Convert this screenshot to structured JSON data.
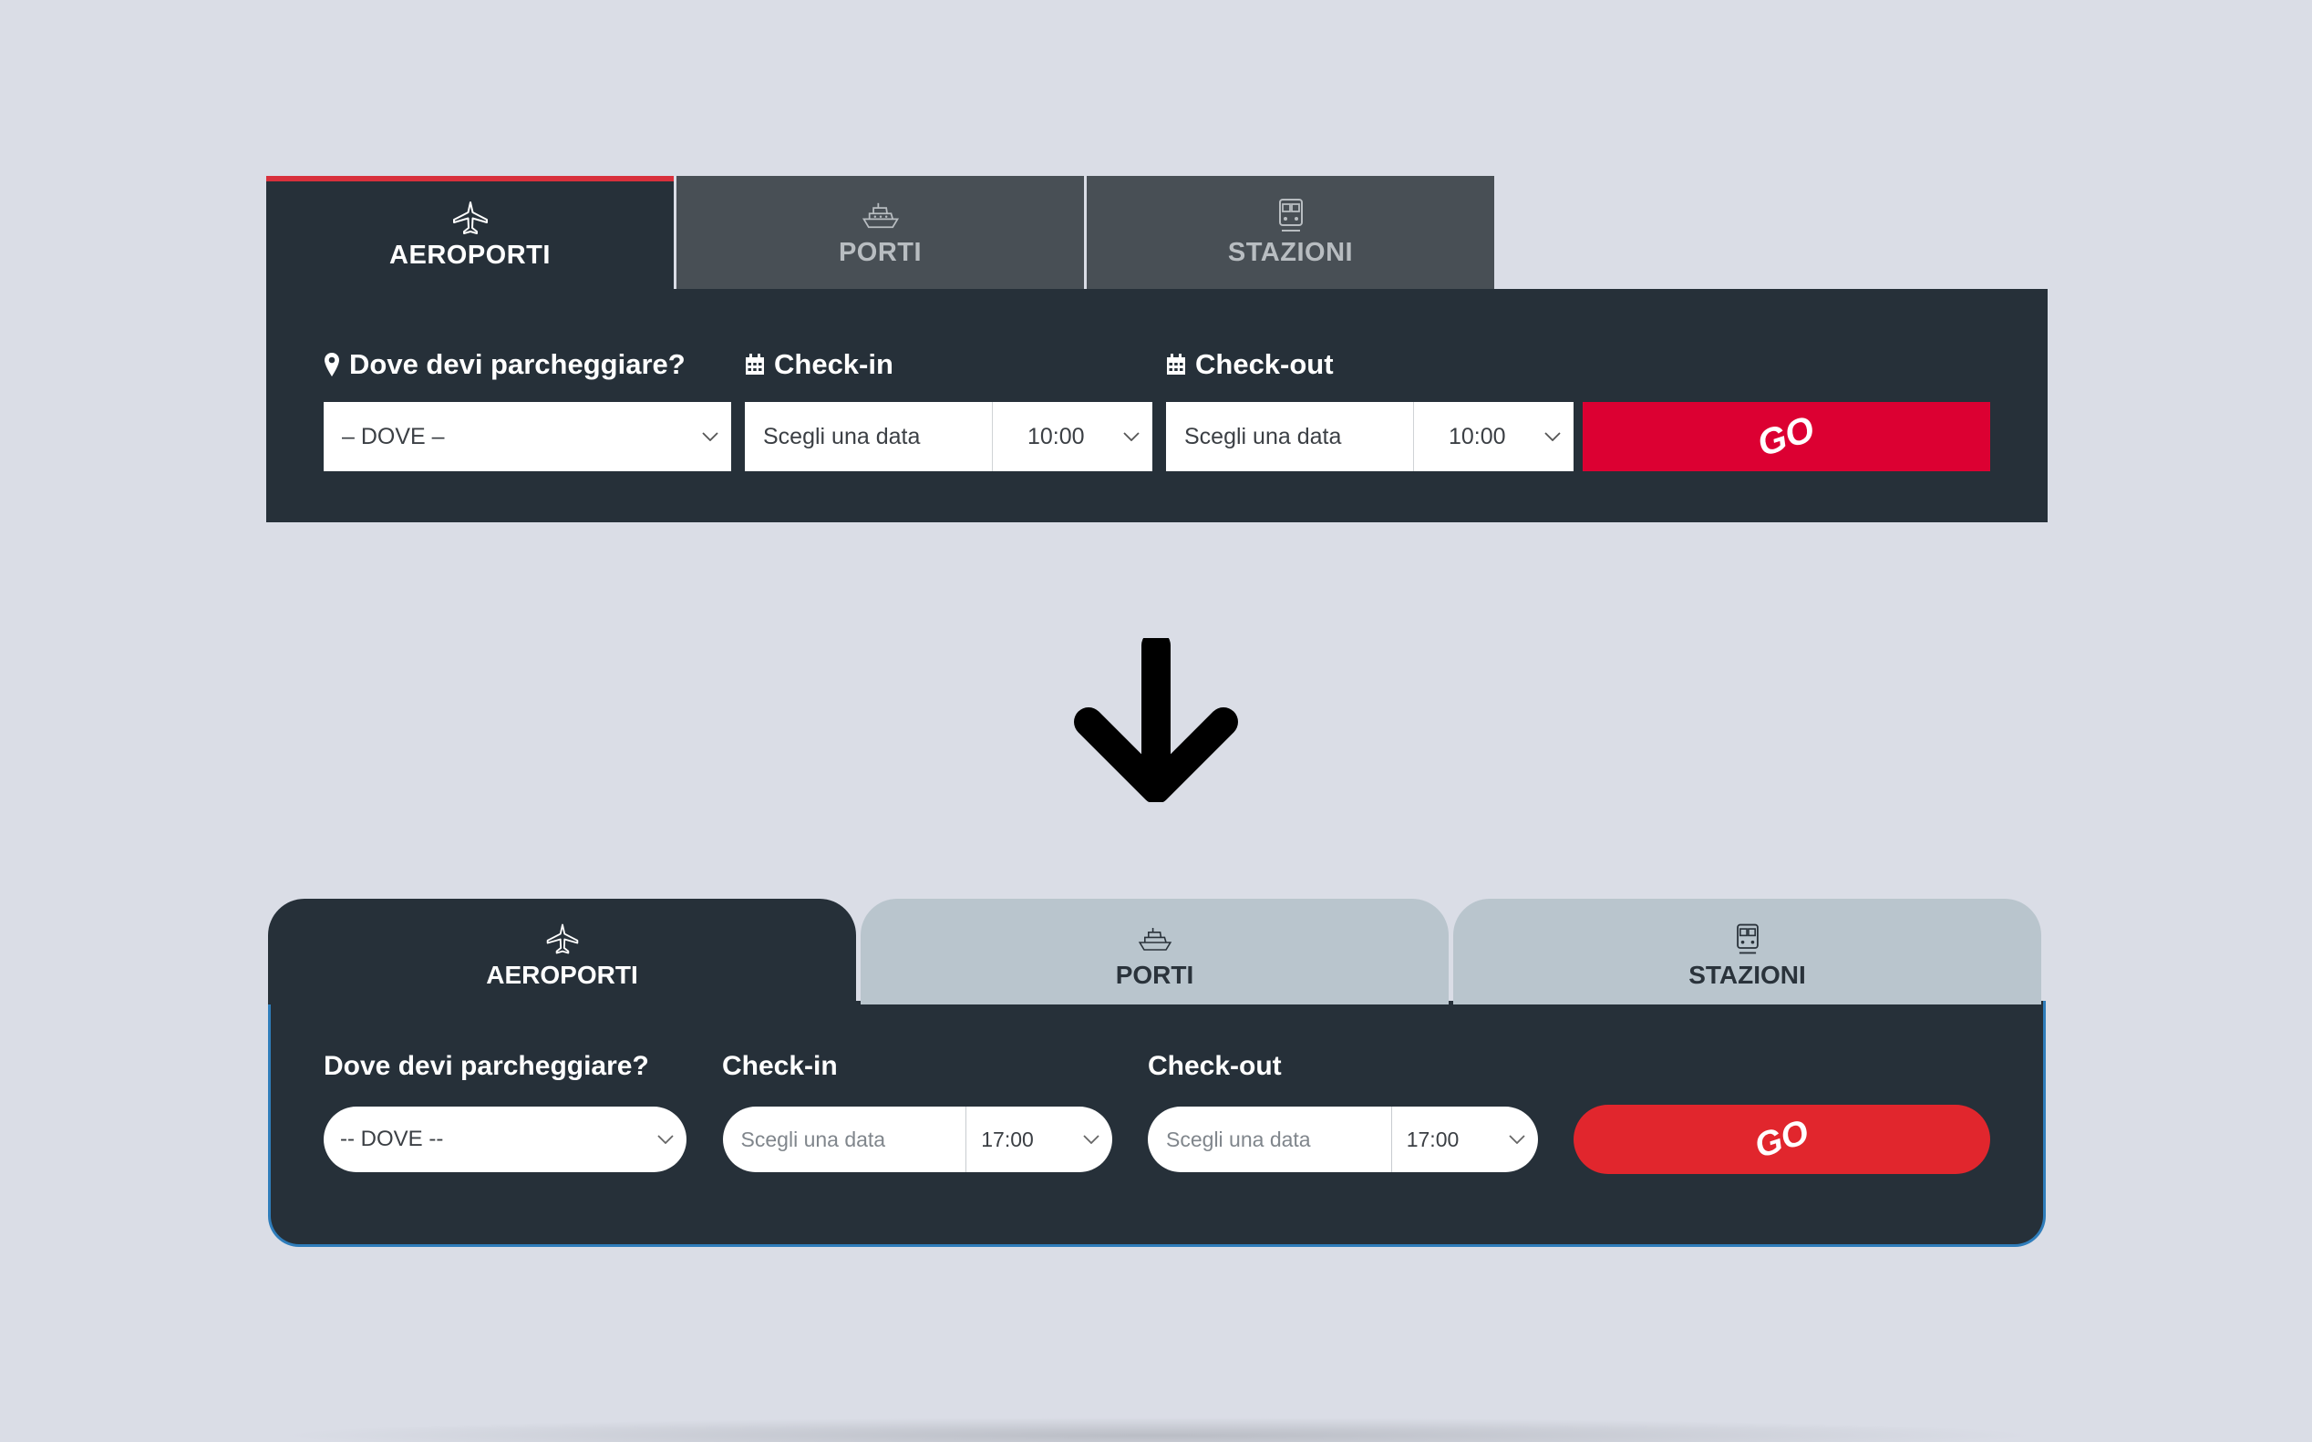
{
  "old_widget": {
    "tabs": [
      {
        "label": "AEROPORTI",
        "icon": "airplane-icon",
        "active": true
      },
      {
        "label": "PORTI",
        "icon": "ship-icon",
        "active": false
      },
      {
        "label": "STAZIONI",
        "icon": "train-icon",
        "active": false
      }
    ],
    "labels": {
      "where": "Dove devi parcheggiare?",
      "checkin": "Check-in",
      "checkout": "Check-out"
    },
    "where_select": "– DOVE –",
    "checkin_date_placeholder": "Scegli una data",
    "checkin_time": "10:00",
    "checkout_date_placeholder": "Scegli una data",
    "checkout_time": "10:00",
    "go_label": "GO",
    "colors": {
      "panel": "#263039",
      "tab_inactive": "#484f55",
      "accent": "#d8303c",
      "go": "#dc0032"
    }
  },
  "new_widget": {
    "tabs": [
      {
        "label": "AEROPORTI",
        "icon": "airplane-icon",
        "active": true
      },
      {
        "label": "PORTI",
        "icon": "ship-icon",
        "active": false
      },
      {
        "label": "STAZIONI",
        "icon": "train-icon",
        "active": false
      }
    ],
    "labels": {
      "where": "Dove devi parcheggiare?",
      "checkin": "Check-in",
      "checkout": "Check-out"
    },
    "where_select": "-- DOVE --",
    "checkin_date_placeholder": "Scegli una data",
    "checkin_time": "17:00",
    "checkout_date_placeholder": "Scegli una data",
    "checkout_time": "17:00",
    "go_label": "GO",
    "colors": {
      "panel": "#263039",
      "tab_inactive": "#b9c5cd",
      "border": "#2f7dbb",
      "go": "#e1262d"
    }
  },
  "arrow_icon": "arrow-down-icon"
}
